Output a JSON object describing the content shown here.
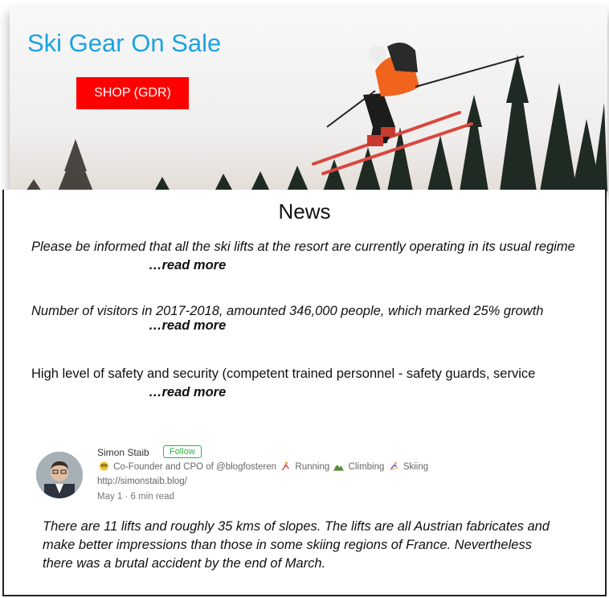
{
  "hero": {
    "title": "Ski Gear On Sale",
    "shop_button": "SHOP (GDR)",
    "title_color": "#1aa3e0",
    "button_color": "#ff0000"
  },
  "news": {
    "heading": "News",
    "items": [
      {
        "text": "Please be informed that all the ski lifts at the resort are currently operating in its usual regime",
        "link": "…read more"
      },
      {
        "text": "Number of visitors in 2017-2018, amounted 346,000 people, which marked 25% growth",
        "link": "…read more"
      },
      {
        "text": "High level of safety and security (competent trained personnel - safety guards, service",
        "link": "…read more"
      }
    ]
  },
  "author": {
    "name": "Simon Staib",
    "follow": "Follow",
    "bio_prefix": "Co-Founder and CPO of @blogfosteren",
    "bio_running": "Running",
    "bio_climbing": "Climbing",
    "bio_skiing": "Skiing",
    "url": "http://simonstaib.blog/",
    "meta": "May 1 · 6 min read",
    "follow_color": "#2bb24c"
  },
  "story": {
    "text": "There are 11 lifts and roughly 35 kms of slopes. The lifts are all Austrian fabricates and make better impressions than those in some skiing regions of France. Nevertheless there was a brutal accident by the end of March."
  }
}
